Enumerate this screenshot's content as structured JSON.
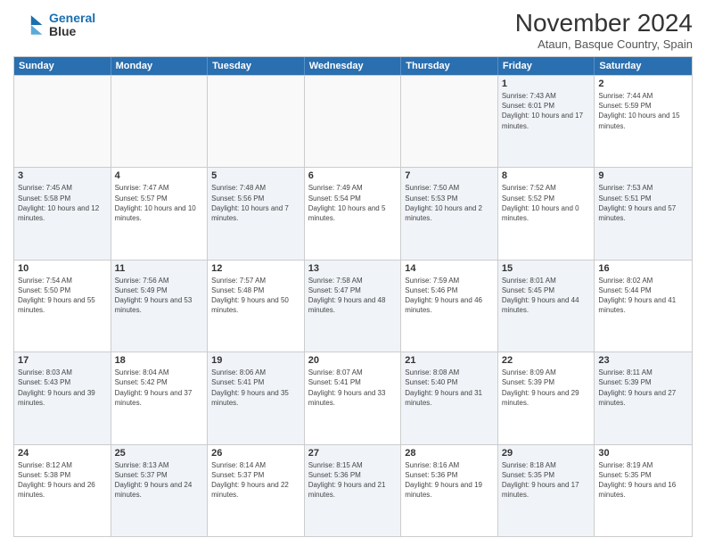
{
  "header": {
    "logo_line1": "General",
    "logo_line2": "Blue",
    "month_title": "November 2024",
    "subtitle": "Ataun, Basque Country, Spain"
  },
  "days_of_week": [
    "Sunday",
    "Monday",
    "Tuesday",
    "Wednesday",
    "Thursday",
    "Friday",
    "Saturday"
  ],
  "rows": [
    [
      {
        "day": "",
        "info": "",
        "shaded": false,
        "empty": true
      },
      {
        "day": "",
        "info": "",
        "shaded": false,
        "empty": true
      },
      {
        "day": "",
        "info": "",
        "shaded": false,
        "empty": true
      },
      {
        "day": "",
        "info": "",
        "shaded": false,
        "empty": true
      },
      {
        "day": "",
        "info": "",
        "shaded": false,
        "empty": true
      },
      {
        "day": "1",
        "info": "Sunrise: 7:43 AM\nSunset: 6:01 PM\nDaylight: 10 hours and 17 minutes.",
        "shaded": true,
        "empty": false
      },
      {
        "day": "2",
        "info": "Sunrise: 7:44 AM\nSunset: 5:59 PM\nDaylight: 10 hours and 15 minutes.",
        "shaded": false,
        "empty": false
      }
    ],
    [
      {
        "day": "3",
        "info": "Sunrise: 7:45 AM\nSunset: 5:58 PM\nDaylight: 10 hours and 12 minutes.",
        "shaded": true,
        "empty": false
      },
      {
        "day": "4",
        "info": "Sunrise: 7:47 AM\nSunset: 5:57 PM\nDaylight: 10 hours and 10 minutes.",
        "shaded": false,
        "empty": false
      },
      {
        "day": "5",
        "info": "Sunrise: 7:48 AM\nSunset: 5:56 PM\nDaylight: 10 hours and 7 minutes.",
        "shaded": true,
        "empty": false
      },
      {
        "day": "6",
        "info": "Sunrise: 7:49 AM\nSunset: 5:54 PM\nDaylight: 10 hours and 5 minutes.",
        "shaded": false,
        "empty": false
      },
      {
        "day": "7",
        "info": "Sunrise: 7:50 AM\nSunset: 5:53 PM\nDaylight: 10 hours and 2 minutes.",
        "shaded": true,
        "empty": false
      },
      {
        "day": "8",
        "info": "Sunrise: 7:52 AM\nSunset: 5:52 PM\nDaylight: 10 hours and 0 minutes.",
        "shaded": false,
        "empty": false
      },
      {
        "day": "9",
        "info": "Sunrise: 7:53 AM\nSunset: 5:51 PM\nDaylight: 9 hours and 57 minutes.",
        "shaded": true,
        "empty": false
      }
    ],
    [
      {
        "day": "10",
        "info": "Sunrise: 7:54 AM\nSunset: 5:50 PM\nDaylight: 9 hours and 55 minutes.",
        "shaded": false,
        "empty": false
      },
      {
        "day": "11",
        "info": "Sunrise: 7:56 AM\nSunset: 5:49 PM\nDaylight: 9 hours and 53 minutes.",
        "shaded": true,
        "empty": false
      },
      {
        "day": "12",
        "info": "Sunrise: 7:57 AM\nSunset: 5:48 PM\nDaylight: 9 hours and 50 minutes.",
        "shaded": false,
        "empty": false
      },
      {
        "day": "13",
        "info": "Sunrise: 7:58 AM\nSunset: 5:47 PM\nDaylight: 9 hours and 48 minutes.",
        "shaded": true,
        "empty": false
      },
      {
        "day": "14",
        "info": "Sunrise: 7:59 AM\nSunset: 5:46 PM\nDaylight: 9 hours and 46 minutes.",
        "shaded": false,
        "empty": false
      },
      {
        "day": "15",
        "info": "Sunrise: 8:01 AM\nSunset: 5:45 PM\nDaylight: 9 hours and 44 minutes.",
        "shaded": true,
        "empty": false
      },
      {
        "day": "16",
        "info": "Sunrise: 8:02 AM\nSunset: 5:44 PM\nDaylight: 9 hours and 41 minutes.",
        "shaded": false,
        "empty": false
      }
    ],
    [
      {
        "day": "17",
        "info": "Sunrise: 8:03 AM\nSunset: 5:43 PM\nDaylight: 9 hours and 39 minutes.",
        "shaded": true,
        "empty": false
      },
      {
        "day": "18",
        "info": "Sunrise: 8:04 AM\nSunset: 5:42 PM\nDaylight: 9 hours and 37 minutes.",
        "shaded": false,
        "empty": false
      },
      {
        "day": "19",
        "info": "Sunrise: 8:06 AM\nSunset: 5:41 PM\nDaylight: 9 hours and 35 minutes.",
        "shaded": true,
        "empty": false
      },
      {
        "day": "20",
        "info": "Sunrise: 8:07 AM\nSunset: 5:41 PM\nDaylight: 9 hours and 33 minutes.",
        "shaded": false,
        "empty": false
      },
      {
        "day": "21",
        "info": "Sunrise: 8:08 AM\nSunset: 5:40 PM\nDaylight: 9 hours and 31 minutes.",
        "shaded": true,
        "empty": false
      },
      {
        "day": "22",
        "info": "Sunrise: 8:09 AM\nSunset: 5:39 PM\nDaylight: 9 hours and 29 minutes.",
        "shaded": false,
        "empty": false
      },
      {
        "day": "23",
        "info": "Sunrise: 8:11 AM\nSunset: 5:39 PM\nDaylight: 9 hours and 27 minutes.",
        "shaded": true,
        "empty": false
      }
    ],
    [
      {
        "day": "24",
        "info": "Sunrise: 8:12 AM\nSunset: 5:38 PM\nDaylight: 9 hours and 26 minutes.",
        "shaded": false,
        "empty": false
      },
      {
        "day": "25",
        "info": "Sunrise: 8:13 AM\nSunset: 5:37 PM\nDaylight: 9 hours and 24 minutes.",
        "shaded": true,
        "empty": false
      },
      {
        "day": "26",
        "info": "Sunrise: 8:14 AM\nSunset: 5:37 PM\nDaylight: 9 hours and 22 minutes.",
        "shaded": false,
        "empty": false
      },
      {
        "day": "27",
        "info": "Sunrise: 8:15 AM\nSunset: 5:36 PM\nDaylight: 9 hours and 21 minutes.",
        "shaded": true,
        "empty": false
      },
      {
        "day": "28",
        "info": "Sunrise: 8:16 AM\nSunset: 5:36 PM\nDaylight: 9 hours and 19 minutes.",
        "shaded": false,
        "empty": false
      },
      {
        "day": "29",
        "info": "Sunrise: 8:18 AM\nSunset: 5:35 PM\nDaylight: 9 hours and 17 minutes.",
        "shaded": true,
        "empty": false
      },
      {
        "day": "30",
        "info": "Sunrise: 8:19 AM\nSunset: 5:35 PM\nDaylight: 9 hours and 16 minutes.",
        "shaded": false,
        "empty": false
      }
    ]
  ]
}
